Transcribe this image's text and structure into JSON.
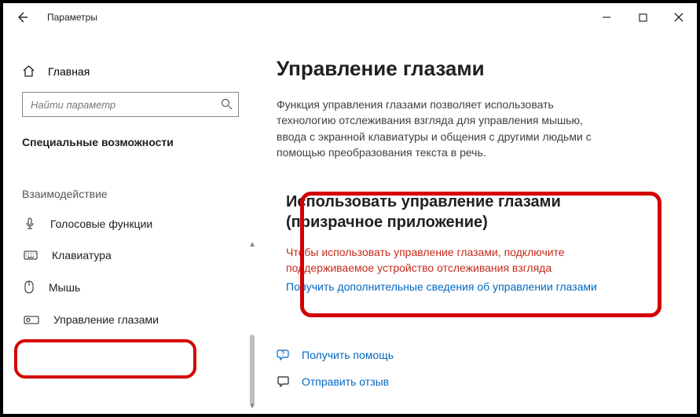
{
  "window": {
    "title": "Параметры"
  },
  "sidebar": {
    "home": "Главная",
    "search_placeholder": "Найти параметр",
    "section": "Специальные возможности",
    "group": "Взаимодействие",
    "items": [
      {
        "label": "Голосовые функции"
      },
      {
        "label": "Клавиатура"
      },
      {
        "label": "Мышь"
      },
      {
        "label": "Управление глазами"
      }
    ]
  },
  "main": {
    "title": "Управление глазами",
    "description": "Функция управления глазами позволяет использовать технологию отслеживания взгляда для управления мышью, ввода с экранной клавиатуры и общения с другими людьми с помощью преобразования текста в речь.",
    "section_title": "Использовать управление глазами (призрачное приложение)",
    "warning": "Чтобы использовать управление глазами, подключите поддерживаемое устройство отслеживания взгляда",
    "link": "Получить дополнительные сведения об управлении глазами",
    "help": "Получить помощь",
    "feedback": "Отправить отзыв"
  }
}
